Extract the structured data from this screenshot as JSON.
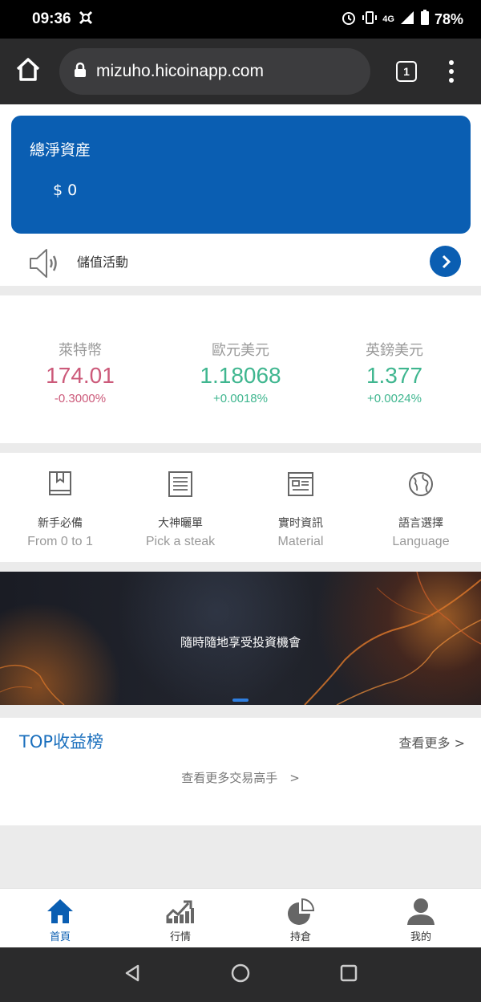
{
  "status_bar": {
    "time": "09:36",
    "network": "4G",
    "battery": "78%"
  },
  "browser": {
    "url": "mizuho.hicoinapp.com",
    "tab_count": "1"
  },
  "asset": {
    "title": "總淨資産",
    "value": "$ 0",
    "card_color": "#0a5eb2"
  },
  "notice": {
    "label": "儲值活動"
  },
  "quotes": [
    {
      "name": "萊特幣",
      "price": "174.01",
      "change": "-0.3000%",
      "direction": "down"
    },
    {
      "name": "歐元美元",
      "price": "1.18068",
      "change": "+0.0018%",
      "direction": "up"
    },
    {
      "name": "英鎊美元",
      "price": "1.377",
      "change": "+0.0024%",
      "direction": "up"
    }
  ],
  "colors": {
    "down": "#cc5a7a",
    "up": "#3fb68f",
    "accent": "#0a5eb2"
  },
  "menu": [
    {
      "cn": "新手必備",
      "en": "From 0 to 1",
      "icon": "book-icon"
    },
    {
      "cn": "大神曬單",
      "en": "Pick a steak",
      "icon": "list-icon"
    },
    {
      "cn": "實时資訊",
      "en": "Material",
      "icon": "news-icon"
    },
    {
      "cn": "語言選擇",
      "en": "Language",
      "icon": "globe-icon"
    }
  ],
  "banner": {
    "text": "隨時隨地享受投資機會"
  },
  "top": {
    "title": "TOP收益榜",
    "more": "查看更多 >",
    "link": "查看更多交易高手　>"
  },
  "bottom_nav": [
    {
      "label": "首頁",
      "icon": "home-icon",
      "active": true
    },
    {
      "label": "行情",
      "icon": "market-chart-icon",
      "active": false
    },
    {
      "label": "持倉",
      "icon": "pie-chart-icon",
      "active": false
    },
    {
      "label": "我的",
      "icon": "user-icon",
      "active": false
    }
  ]
}
